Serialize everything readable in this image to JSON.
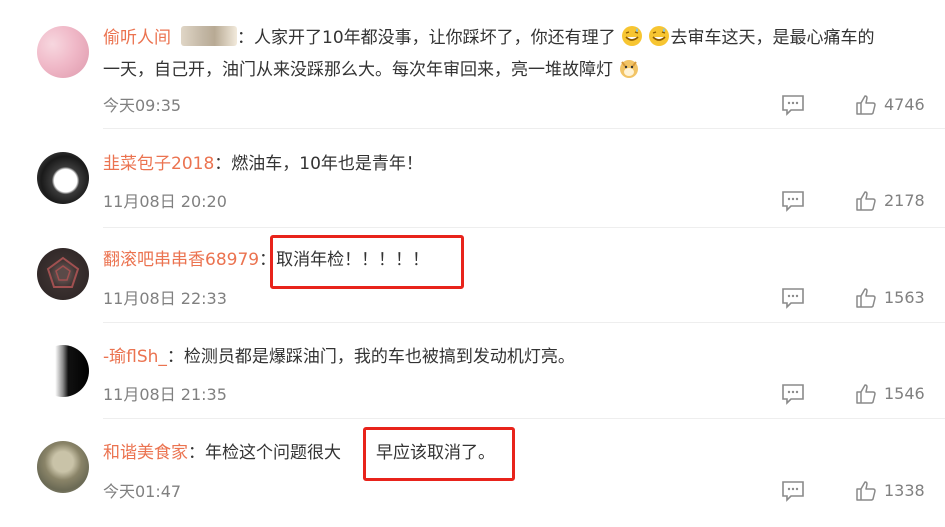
{
  "comments": [
    {
      "username": "偷听人间",
      "text_line1_a": "：人家开了10年都没事，让你踩坏了，你还有理了",
      "text_line1_b": "去审车这天，是最心痛车的",
      "text_line2": "一天，自己开，油门从来没踩那么大。每次年审回来，亮一堆故障灯",
      "time": "今天09:35",
      "likes": "4746"
    },
    {
      "username": "韭菜包子2018",
      "text": "：燃油车，10年也是青年！",
      "time": "11月08日 20:20",
      "likes": "2178"
    },
    {
      "username": "翻滚吧串串香68979",
      "text": "：取消年检！！！！！",
      "time": "11月08日 22:33",
      "likes": "1563"
    },
    {
      "username": "-瑜flSh_",
      "text": "：检测员都是爆踩油门，我的车也被搞到发动机灯亮。",
      "time": "11月08日 21:35",
      "likes": "1546"
    },
    {
      "username": "和谐美食家",
      "text_a": "：年检这个问题很大",
      "text_b": "早应该取消了。",
      "time": "今天01:47",
      "likes": "1338"
    }
  ],
  "icons": {
    "reply": "comment-icon",
    "like": "thumbs-up-icon",
    "emoji_grin": "grin-sweat-emoji-icon",
    "emoji_dog": "doge-emoji-icon"
  },
  "colors": {
    "username": "#eb7350",
    "highlight_box": "#e8231b",
    "meta_text": "#808080"
  }
}
